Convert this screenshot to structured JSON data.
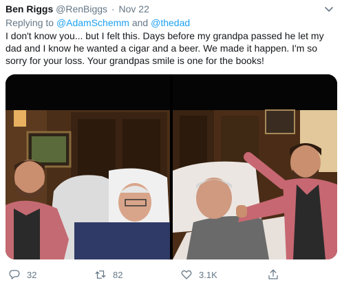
{
  "tweet": {
    "author_name": "Ben Riggs",
    "handle": "@RenBiggs",
    "separator": "·",
    "date": "Nov 22",
    "reply_prefix": "Replying to",
    "reply_to_1": "@AdamSchemm",
    "reply_and": "and",
    "reply_to_2": "@thedad",
    "text": "I don't know you... but I felt this. Days before my grandpa passed he let my dad and I know he wanted a cigar and a beer. We made it happen. I'm so sorry for your loss. Your grandpas smile is one for the books!"
  },
  "actions": {
    "replies": "32",
    "retweets": "82",
    "likes": "3.1K"
  },
  "colors": {
    "text": "#14171a",
    "muted": "#657786",
    "link": "#1da1f2"
  },
  "icons": [
    "chevron-down-icon",
    "reply-icon",
    "retweet-icon",
    "like-icon",
    "share-icon"
  ]
}
